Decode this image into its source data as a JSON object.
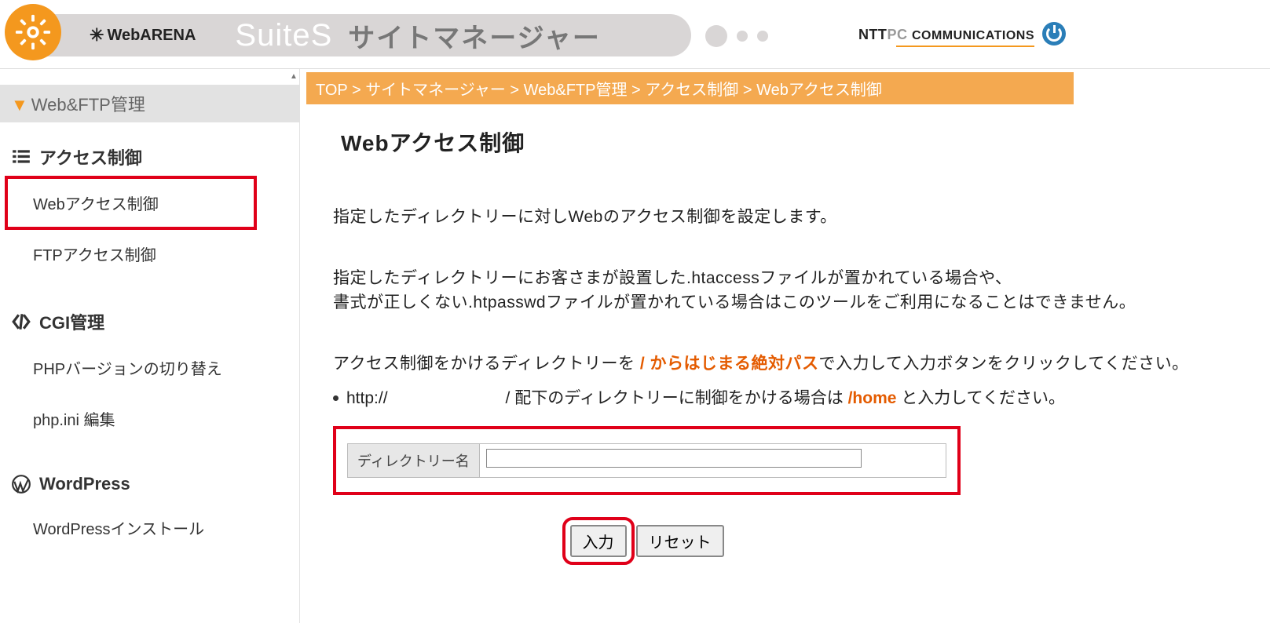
{
  "header": {
    "logo_text": "WebARENA",
    "brand_suites": "SuiteS",
    "brand_sitemanager": "サイトマネージャー",
    "nttpc_ntt": "NTT",
    "nttpc_pc": "PC",
    "nttpc_comm": "COMMUNICATIONS"
  },
  "sidebar": {
    "section_header": "Web&FTP管理",
    "groups": [
      {
        "title": "アクセス制御",
        "icon": "list-icon",
        "items": [
          {
            "label": "Webアクセス制御",
            "highlighted": true
          },
          {
            "label": "FTPアクセス制御",
            "highlighted": false
          }
        ]
      },
      {
        "title": "CGI管理",
        "icon": "code-icon",
        "items": [
          {
            "label": "PHPバージョンの切り替え",
            "highlighted": false
          },
          {
            "label": "php.ini 編集",
            "highlighted": false
          }
        ]
      },
      {
        "title": "WordPress",
        "icon": "wordpress-icon",
        "items": [
          {
            "label": "WordPressインストール",
            "highlighted": false
          }
        ]
      }
    ]
  },
  "breadcrumb": {
    "items": [
      "TOP",
      "サイトマネージャー",
      "Web&FTP管理",
      "アクセス制御",
      "Webアクセス制御"
    ],
    "separator": " > "
  },
  "page": {
    "title": "Webアクセス制御",
    "para1": "指定したディレクトリーに対しWebのアクセス制御を設定します。",
    "para2a": "指定したディレクトリーにお客さまが設置した.htaccessファイルが置かれている場合や、",
    "para2b": "書式が正しくない.htpasswdファイルが置かれている場合はこのツールをご利用になることはできません。",
    "para3_pre": "アクセス制御をかけるディレクトリーを ",
    "para3_orange": "/ からはじまる絶対パス",
    "para3_post": "で入力して入力ボタンをクリックしてください。",
    "bullet_http": "http://",
    "bullet_mid": "/ 配下のディレクトリーに制御をかける場合は ",
    "bullet_home_orange": "/home",
    "bullet_tail": " と入力してください。",
    "form_label": "ディレクトリー名",
    "form_value": "",
    "btn_submit": "入力",
    "btn_reset": "リセット"
  }
}
